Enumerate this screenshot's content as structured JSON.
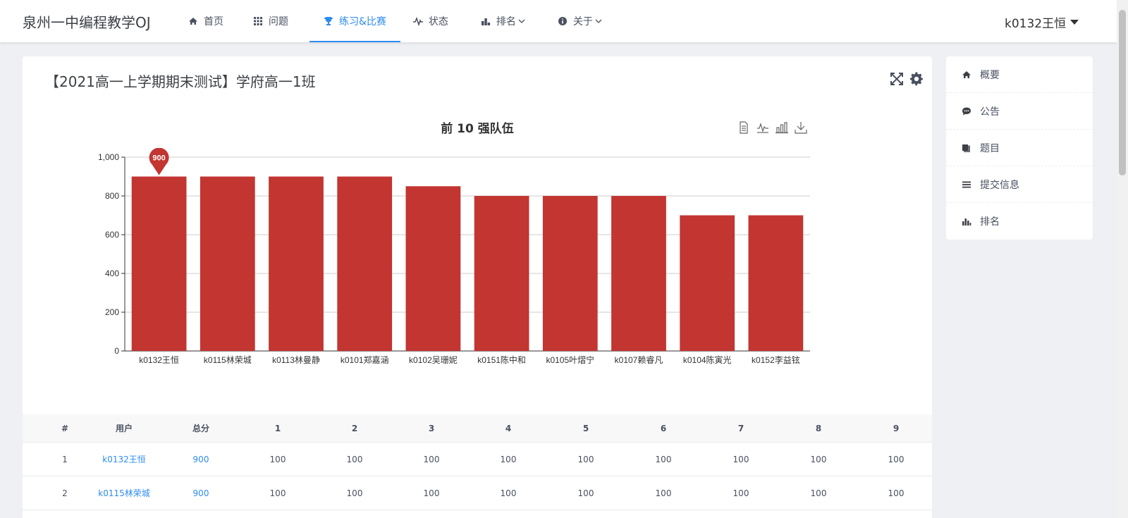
{
  "brand": "泉州一中编程教学OJ",
  "nav": [
    {
      "label": "首页",
      "icon": "home-icon",
      "active": false,
      "dropdown": false
    },
    {
      "label": "问题",
      "icon": "grid-icon",
      "active": false,
      "dropdown": false
    },
    {
      "label": "练习&比赛",
      "icon": "trophy-icon",
      "active": true,
      "dropdown": false
    },
    {
      "label": "状态",
      "icon": "pulse-icon",
      "active": false,
      "dropdown": false
    },
    {
      "label": "排名",
      "icon": "podium-icon",
      "active": false,
      "dropdown": true
    },
    {
      "label": "关于",
      "icon": "info-icon",
      "active": false,
      "dropdown": true
    }
  ],
  "user": "k0132王恒",
  "contest_title": "【2021高一上学期期末测试】学府高一1班",
  "chart_data": {
    "type": "bar",
    "title": "前 10 强队伍",
    "categories": [
      "k0132王恒",
      "k0115林荣城",
      "k0113林曼静",
      "k0101郑嘉涵",
      "k0102吴珊妮",
      "k0151陈中和",
      "k0105叶熠宁",
      "k0107赖睿凡",
      "k0104陈寅光",
      "k0152李益铉"
    ],
    "values": [
      900,
      900,
      900,
      900,
      850,
      800,
      800,
      800,
      700,
      700
    ],
    "yticks": [
      "0",
      "200",
      "400",
      "600",
      "800",
      "1,000"
    ],
    "ylim": [
      0,
      1000
    ],
    "max_marker": "900",
    "color": "#c23531",
    "grid": true
  },
  "table": {
    "headers": [
      "#",
      "用户",
      "总分",
      "1",
      "2",
      "3",
      "4",
      "5",
      "6",
      "7",
      "8",
      "9"
    ],
    "rows": [
      {
        "rank": "1",
        "user": "k0132王恒",
        "total": "900",
        "scores": [
          "100",
          "100",
          "100",
          "100",
          "100",
          "100",
          "100",
          "100",
          "100"
        ]
      },
      {
        "rank": "2",
        "user": "k0115林荣城",
        "total": "900",
        "scores": [
          "100",
          "100",
          "100",
          "100",
          "100",
          "100",
          "100",
          "100",
          "100"
        ]
      }
    ]
  },
  "sidebar": [
    {
      "label": "概要",
      "icon": "home-icon"
    },
    {
      "label": "公告",
      "icon": "chat-icon"
    },
    {
      "label": "题目",
      "icon": "book-icon"
    },
    {
      "label": "提交信息",
      "icon": "list-icon"
    },
    {
      "label": "排名",
      "icon": "podium-icon"
    }
  ]
}
